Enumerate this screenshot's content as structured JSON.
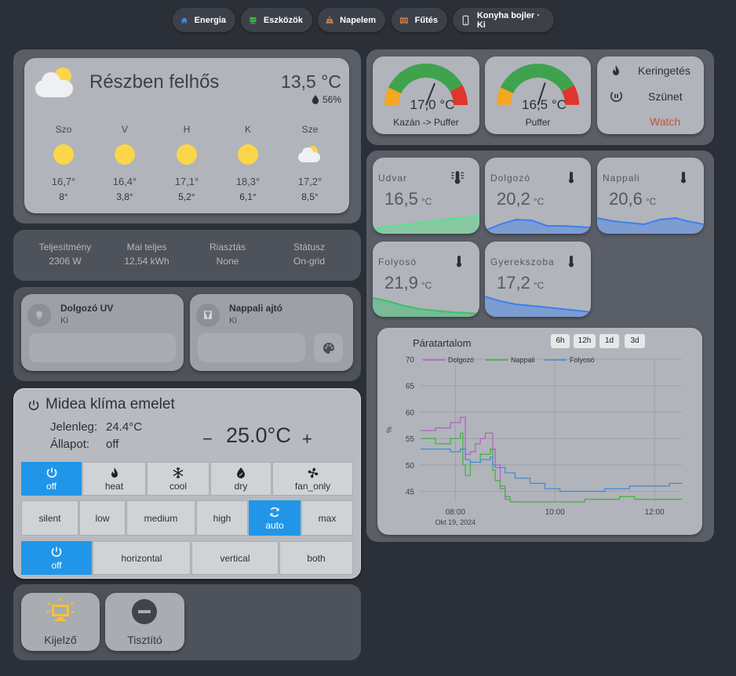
{
  "chips": [
    {
      "label": "Energia",
      "icon": "home-icon"
    },
    {
      "label": "Eszközök",
      "icon": "server-icon"
    },
    {
      "label": "Napelem",
      "icon": "solar-panel-icon"
    },
    {
      "label": "Fűtés",
      "icon": "radiator-icon"
    },
    {
      "label": "Konyha bojler · Ki",
      "icon": "phone-icon"
    }
  ],
  "weather": {
    "condition": "Részben felhős",
    "temperature": "13,5 °C",
    "humidity": "56%",
    "days": [
      {
        "day": "Szo",
        "icon": "sun-icon",
        "high": "16,7°",
        "low": "8°"
      },
      {
        "day": "V",
        "icon": "sun-icon",
        "high": "16,4°",
        "low": "3,8°"
      },
      {
        "day": "H",
        "icon": "sun-icon",
        "high": "17,1°",
        "low": "5,2°"
      },
      {
        "day": "K",
        "icon": "sun-icon",
        "high": "18,3°",
        "low": "6,1°"
      },
      {
        "day": "Sze",
        "icon": "cloudy-icon",
        "high": "17,2°",
        "low": "8,5°"
      }
    ]
  },
  "solar": [
    {
      "label": "Teljesítmény",
      "value": "2306 W"
    },
    {
      "label": "Mai teljes",
      "value": "12,54 kWh"
    },
    {
      "label": "Riasztás",
      "value": "None"
    },
    {
      "label": "Státusz",
      "value": "On-grid"
    }
  ],
  "devices": [
    {
      "name": "Dolgozó UV",
      "state": "Ki"
    },
    {
      "name": "Nappali ajtó",
      "state": "Ki"
    }
  ],
  "climate": {
    "title": "Midea klíma emelet",
    "current_label": "Jelenleg:",
    "current_value": "24.4°C",
    "state_label": "Állapot:",
    "state_value": "off",
    "target": "25.0°C",
    "minus": "−",
    "plus": "+",
    "hvac_modes": [
      "off",
      "heat",
      "cool",
      "dry",
      "fan_only"
    ],
    "fan_modes": [
      "silent",
      "low",
      "medium",
      "high",
      "auto",
      "max"
    ],
    "swing_modes": [
      "off",
      "horizontal",
      "vertical",
      "both"
    ],
    "active_hvac": "off",
    "active_fan": "auto",
    "active_swing": "off",
    "active_color": "#2196e8"
  },
  "bottom_buttons": [
    {
      "label": "Kijelző",
      "icon": "monitor-icon"
    },
    {
      "label": "Tisztító",
      "icon": "minus-circle-icon"
    }
  ],
  "gauges": [
    {
      "value": "17,0 °C",
      "label": "Kazán -> Puffer",
      "fraction": 0.62
    },
    {
      "value": "16,5 °C",
      "label": "Puffer",
      "fraction": 0.6
    }
  ],
  "pump": {
    "items": [
      "Keringetés",
      "Szünet",
      "Watch"
    ],
    "watch_color": "#c0553a"
  },
  "sensors": [
    {
      "name": "Udvar",
      "value": "16,5",
      "unit": "°C",
      "icon": "thermometer-lines-icon",
      "color": "#57e389"
    },
    {
      "name": "Dolgozó",
      "value": "20,2",
      "unit": "°C",
      "icon": "thermometer-icon",
      "color": "#3d7ef0"
    },
    {
      "name": "Nappali",
      "value": "20,6",
      "unit": "°C",
      "icon": "thermometer-icon",
      "color": "#3d7ef0"
    },
    {
      "name": "Folyosó",
      "value": "21,9",
      "unit": "°C",
      "icon": "thermometer-icon",
      "color": "#33c46b"
    },
    {
      "name": "Gyerekszoba",
      "value": "17,2",
      "unit": "°C",
      "icon": "thermometer-icon",
      "color": "#3d7ef0"
    }
  ],
  "humidity_chart": {
    "title": "Páratartalom",
    "ranges": [
      "6h",
      "12h",
      "1d",
      "3d"
    ],
    "ylabel": "%",
    "date_label": "Okt 19, 2024"
  },
  "chart_data": {
    "type": "line",
    "title": "Páratartalom",
    "ylabel": "%",
    "ylim": [
      43,
      70
    ],
    "yticks": [
      45,
      50,
      55,
      60,
      65,
      70
    ],
    "xlim": [
      7.3,
      12.55
    ],
    "xticks": [
      {
        "v": 8,
        "label": "08:00"
      },
      {
        "v": 10,
        "label": "10:00"
      },
      {
        "v": 12,
        "label": "12:00"
      }
    ],
    "legend_position": "top",
    "series": [
      {
        "name": "Dolgozó",
        "color": "#b45cc8",
        "x": [
          7.3,
          7.6,
          7.9,
          8.1,
          8.2,
          8.3,
          8.4,
          8.5,
          8.6,
          8.7,
          8.75,
          8.8,
          8.9,
          9.0,
          9.1,
          9.2
        ],
        "y": [
          56.5,
          57,
          58,
          59,
          52,
          52.5,
          54,
          55,
          56,
          56,
          53,
          50,
          46,
          43.5,
          43,
          43
        ]
      },
      {
        "name": "Nappali",
        "color": "#3ab43a",
        "x": [
          7.3,
          7.6,
          7.9,
          8.1,
          8.15,
          8.2,
          8.3,
          8.5,
          8.7,
          8.75,
          8.8,
          8.9,
          9.0,
          9.1,
          9.2,
          9.5,
          10.0,
          10.3,
          10.6,
          11.0,
          11.3,
          11.6,
          12.0,
          12.3,
          12.55
        ],
        "y": [
          55,
          54,
          55,
          56,
          50,
          48,
          50.5,
          52,
          53,
          49,
          47,
          45.5,
          44,
          43,
          43,
          43,
          43,
          43,
          43.5,
          43.5,
          44,
          43.5,
          43.5,
          43.5,
          43.5
        ]
      },
      {
        "name": "Folyosó",
        "color": "#3c8ad6",
        "x": [
          7.3,
          7.6,
          7.9,
          8.1,
          8.2,
          8.3,
          8.5,
          8.7,
          8.75,
          8.8,
          9.0,
          9.2,
          9.5,
          9.8,
          10.1,
          10.5,
          11.0,
          11.5,
          12.0,
          12.3,
          12.55
        ],
        "y": [
          53,
          53,
          52.5,
          53,
          51,
          50.5,
          51,
          51.5,
          50,
          49.5,
          48.5,
          47.5,
          46.5,
          45.5,
          45,
          45,
          45.5,
          46,
          46,
          46.5,
          46.5
        ]
      }
    ]
  }
}
